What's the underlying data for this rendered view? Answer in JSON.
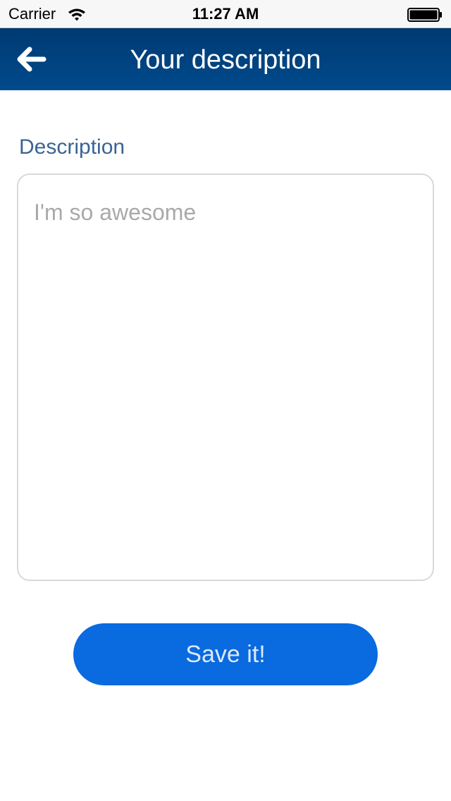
{
  "status_bar": {
    "carrier": "Carrier",
    "time": "11:27 AM",
    "wifi_icon": "wifi-icon",
    "battery_icon": "battery-full-icon"
  },
  "nav": {
    "title": "Your description",
    "back_icon": "arrow-left-icon",
    "background_color": "#004080"
  },
  "form": {
    "label": "Description",
    "value": "",
    "placeholder": "I'm so awesome",
    "label_color": "#3a6494"
  },
  "save": {
    "label": "Save it!",
    "color": "#0a6adf"
  }
}
